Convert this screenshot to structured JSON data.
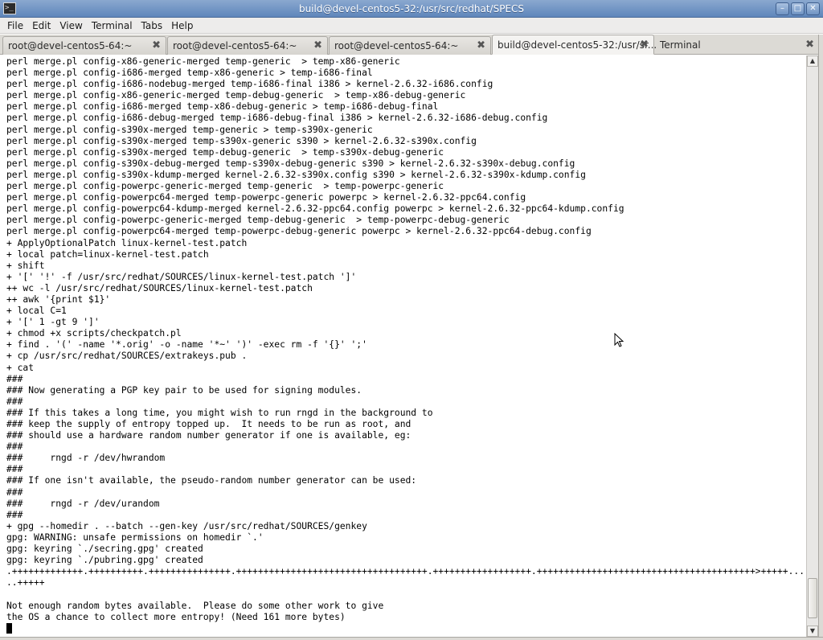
{
  "window": {
    "title": "build@devel-centos5-32:/usr/src/redhat/SPECS",
    "app_icon": "terminal-icon",
    "controls": {
      "minimize": "minimize-icon",
      "maximize": "maximize-icon",
      "close": "close-icon"
    }
  },
  "menu": [
    {
      "label": "File"
    },
    {
      "label": "Edit"
    },
    {
      "label": "View"
    },
    {
      "label": "Terminal"
    },
    {
      "label": "Tabs"
    },
    {
      "label": "Help"
    }
  ],
  "tabs": [
    {
      "label": "root@devel-centos5-64:~",
      "active": false
    },
    {
      "label": "root@devel-centos5-64:~",
      "active": false
    },
    {
      "label": "root@devel-centos5-64:~",
      "active": false
    },
    {
      "label": "build@devel-centos5-32:/usr/sr...",
      "active": true
    },
    {
      "label": "Terminal",
      "active": false
    }
  ],
  "terminal": {
    "lines": [
      "perl merge.pl config-x86-generic-merged temp-generic  > temp-x86-generic",
      "perl merge.pl config-i686-merged temp-x86-generic > temp-i686-final",
      "perl merge.pl config-i686-nodebug-merged temp-i686-final i386 > kernel-2.6.32-i686.config",
      "perl merge.pl config-x86-generic-merged temp-debug-generic  > temp-x86-debug-generic",
      "perl merge.pl config-i686-merged temp-x86-debug-generic > temp-i686-debug-final",
      "perl merge.pl config-i686-debug-merged temp-i686-debug-final i386 > kernel-2.6.32-i686-debug.config",
      "perl merge.pl config-s390x-merged temp-generic > temp-s390x-generic",
      "perl merge.pl config-s390x-merged temp-s390x-generic s390 > kernel-2.6.32-s390x.config",
      "perl merge.pl config-s390x-merged temp-debug-generic  > temp-s390x-debug-generic",
      "perl merge.pl config-s390x-debug-merged temp-s390x-debug-generic s390 > kernel-2.6.32-s390x-debug.config",
      "perl merge.pl config-s390x-kdump-merged kernel-2.6.32-s390x.config s390 > kernel-2.6.32-s390x-kdump.config",
      "perl merge.pl config-powerpc-generic-merged temp-generic  > temp-powerpc-generic",
      "perl merge.pl config-powerpc64-merged temp-powerpc-generic powerpc > kernel-2.6.32-ppc64.config",
      "perl merge.pl config-powerpc64-kdump-merged kernel-2.6.32-ppc64.config powerpc > kernel-2.6.32-ppc64-kdump.config",
      "perl merge.pl config-powerpc-generic-merged temp-debug-generic  > temp-powerpc-debug-generic",
      "perl merge.pl config-powerpc64-merged temp-powerpc-debug-generic powerpc > kernel-2.6.32-ppc64-debug.config",
      "+ ApplyOptionalPatch linux-kernel-test.patch",
      "+ local patch=linux-kernel-test.patch",
      "+ shift",
      "+ '[' '!' -f /usr/src/redhat/SOURCES/linux-kernel-test.patch ']'",
      "++ wc -l /usr/src/redhat/SOURCES/linux-kernel-test.patch",
      "++ awk '{print $1}'",
      "+ local C=1",
      "+ '[' 1 -gt 9 ']'",
      "+ chmod +x scripts/checkpatch.pl",
      "+ find . '(' -name '*.orig' -o -name '*~' ')' -exec rm -f '{}' ';'",
      "+ cp /usr/src/redhat/SOURCES/extrakeys.pub .",
      "+ cat",
      "###",
      "### Now generating a PGP key pair to be used for signing modules.",
      "###",
      "### If this takes a long time, you might wish to run rngd in the background to",
      "### keep the supply of entropy topped up.  It needs to be run as root, and",
      "### should use a hardware random number generator if one is available, eg:",
      "###",
      "###     rngd -r /dev/hwrandom",
      "###",
      "### If one isn't available, the pseudo-random number generator can be used:",
      "###",
      "###     rngd -r /dev/urandom",
      "###",
      "+ gpg --homedir . --batch --gen-key /usr/src/redhat/SOURCES/genkey",
      "gpg: WARNING: unsafe permissions on homedir `.'",
      "gpg: keyring `./secring.gpg' created",
      "gpg: keyring `./pubring.gpg' created",
      ".+++++++++++++.++++++++++.+++++++++++++++.+++++++++++++++++++++++++++++++++++.++++++++++++++++++.++++++++++++++++++++++++++++++++++++++++>+++++...",
      "..+++++",
      "",
      "Not enough random bytes available.  Please do some other work to give",
      "the OS a chance to collect more entropy! (Need 161 more bytes)"
    ]
  },
  "scrollbar": {
    "up_icon": "scroll-up-icon",
    "down_icon": "scroll-down-icon"
  }
}
